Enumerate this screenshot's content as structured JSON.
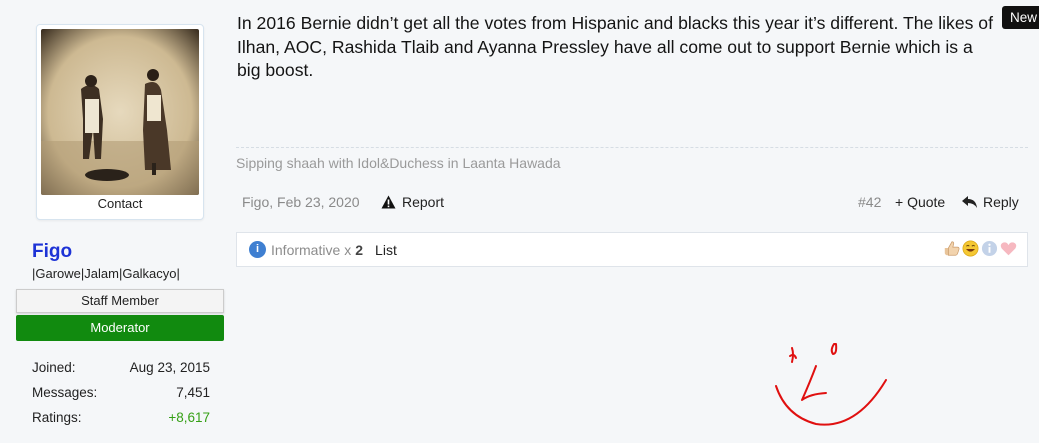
{
  "badge": "New",
  "user": {
    "contact_label": "Contact",
    "name": "Figo",
    "title": "|Garowe|Jalam|Galkacyo|",
    "staff_label": "Staff Member",
    "role_label": "Moderator",
    "role_color": "#118a0f",
    "stats": [
      {
        "label": "Joined:",
        "value": "Aug 23, 2015"
      },
      {
        "label": "Messages:",
        "value": "7,451"
      },
      {
        "label": "Ratings:",
        "value": "+8,617"
      }
    ]
  },
  "post": {
    "message": "In 2016 Bernie didn’t get all the votes from Hispanic and blacks this year it’s different. The likes of Ilhan, AOC, Rashida Tlaib and Ayanna Pressley have all come out to support Bernie which is a big boost.",
    "signature": "Sipping shaah with Idol&Duchess in Laanta Hawada",
    "author_date": "Figo, Feb 23, 2020",
    "report_label": "Report",
    "post_number": "#42",
    "quote_label": "+ Quote",
    "reply_label": "Reply"
  },
  "ratings": {
    "name": "Informative",
    "multiplier": "x",
    "count": "2",
    "list_label": "List",
    "icons": [
      "like-icon",
      "funny-icon",
      "informative-icon",
      "love-icon"
    ]
  }
}
